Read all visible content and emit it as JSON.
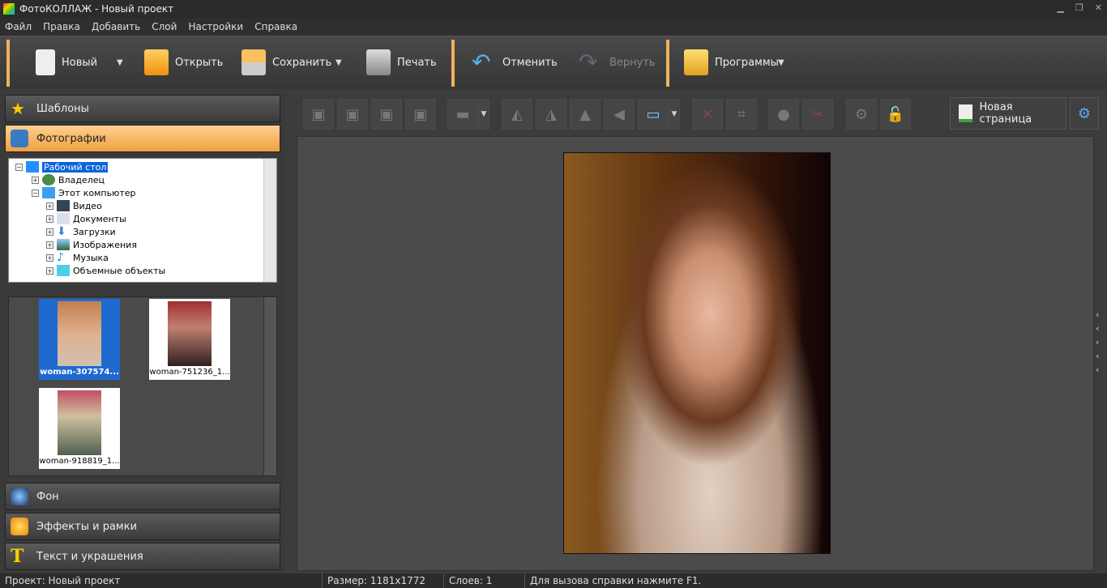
{
  "title": "ФотоКОЛЛАЖ - Новый проект",
  "menu": [
    "Файл",
    "Правка",
    "Добавить",
    "Слой",
    "Настройки",
    "Справка"
  ],
  "toolbar": {
    "new": "Новый",
    "open": "Открыть",
    "save": "Сохранить",
    "print": "Печать",
    "undo": "Отменить",
    "redo": "Вернуть",
    "programs": "Программы"
  },
  "sidebar": {
    "templates": "Шаблоны",
    "photos": "Фотографии",
    "background": "Фон",
    "effects": "Эффекты и рамки",
    "text": "Текст и украшения"
  },
  "tree": [
    "Рабочий стол",
    "Владелец",
    "Этот компьютер",
    "Видео",
    "Документы",
    "Загрузки",
    "Изображения",
    "Музыка",
    "Объемные объекты"
  ],
  "thumbs": [
    "woman-307574...",
    "woman-751236_1...",
    "woman-918819_1..."
  ],
  "editor": {
    "new_page": "Новая страница"
  },
  "status": {
    "project": "Проект:  Новый проект",
    "size": "Размер:  1181x1772",
    "layers": "Слоев:  1",
    "hint": "Для вызова справки нажмите F1."
  },
  "colors": {
    "accent": "#f0a040",
    "selection": "#1e6ad0"
  }
}
